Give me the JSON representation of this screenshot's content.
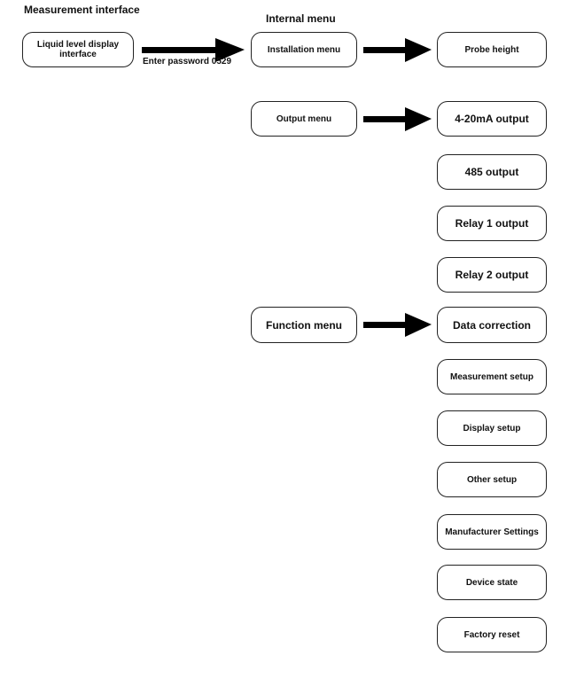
{
  "headings": {
    "measurement": "Measurement interface",
    "internal": "Internal menu"
  },
  "start": {
    "label": "Liquid level display interface",
    "arrow_label": "Enter password 0529"
  },
  "menus": {
    "installation": {
      "label": "Installation menu",
      "items": [
        "Probe height"
      ]
    },
    "output": {
      "label": "Output menu",
      "items": [
        "4-20mA output",
        "485 output",
        "Relay 1 output",
        "Relay 2 output"
      ]
    },
    "function": {
      "label": "Function menu",
      "items": [
        "Data correction",
        "Measurement setup",
        "Display setup",
        "Other setup",
        "Manufacturer Settings",
        "Device state",
        "Factory reset"
      ]
    }
  }
}
